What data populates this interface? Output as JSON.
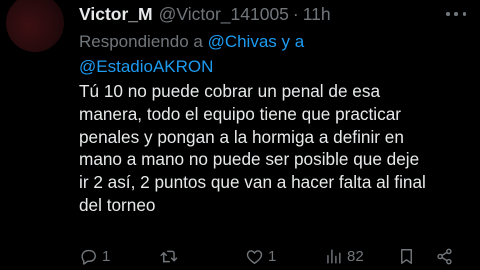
{
  "tweet": {
    "author_name": "Victor_M",
    "author_handle": "@Victor_141005",
    "separator": "·",
    "time": "11h",
    "reply_prefix": "Respondiendo a",
    "reply_mention_1": "@Chivas",
    "reply_and": "y a",
    "reply_mention_2": "@EstadioAKRON",
    "text_lines": [
      "Tú 10 no puede cobrar un penal de esa",
      "manera, todo el equipo tiene que practicar",
      "penales y pongan a la hormiga a definir en",
      "mano a mano no puede ser posible que deje",
      "ir 2 así, 2 puntos que van a hacer falta al final",
      "del torneo"
    ]
  },
  "actions": {
    "reply_count": "1",
    "retweet_count": "",
    "like_count": "1",
    "views_count": "82"
  },
  "colors": {
    "background": "#000000",
    "text": "#e7e9ea",
    "muted": "#71767b",
    "link": "#1d9bf0"
  },
  "icons": [
    "more-icon",
    "reply-icon",
    "retweet-icon",
    "like-icon",
    "views-icon",
    "bookmark-icon",
    "share-icon"
  ]
}
